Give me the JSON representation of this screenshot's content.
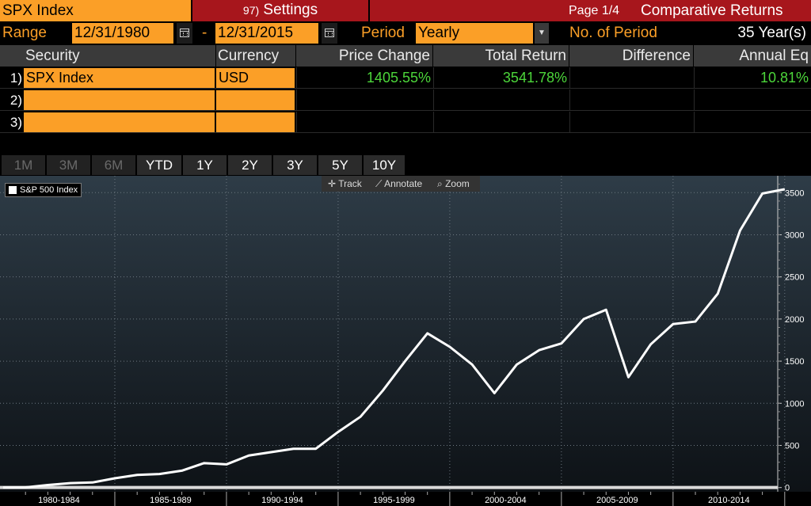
{
  "header": {
    "security": "SPX Index",
    "settings_num": "97)",
    "settings_label": "Settings",
    "page": "Page 1/4",
    "title": "Comparative Returns"
  },
  "range": {
    "label": "Range",
    "start": "12/31/1980",
    "dash": "-",
    "end": "12/31/2015",
    "period_label": "Period",
    "period_value": "Yearly",
    "num_period_label": "No. of Period",
    "num_period_value": "35 Year(s)"
  },
  "table": {
    "columns": [
      "Security",
      "Currency",
      "Price Change",
      "Total Return",
      "Difference",
      "Annual Eq"
    ],
    "rows": [
      {
        "num": "1)",
        "security": "SPX Index",
        "currency": "USD",
        "price_change": "1405.55%",
        "total_return": "3541.78%",
        "difference": "",
        "annual_eq": "10.81%"
      },
      {
        "num": "2)",
        "security": "",
        "currency": "",
        "price_change": "",
        "total_return": "",
        "difference": "",
        "annual_eq": ""
      },
      {
        "num": "3)",
        "security": "",
        "currency": "",
        "price_change": "",
        "total_return": "",
        "difference": "",
        "annual_eq": ""
      }
    ]
  },
  "tabs": [
    "1M",
    "3M",
    "6M",
    "YTD",
    "1Y",
    "2Y",
    "3Y",
    "5Y",
    "10Y"
  ],
  "tabs_disabled": [
    "1M",
    "3M",
    "6M"
  ],
  "toolbar": {
    "track": "Track",
    "annotate": "Annotate",
    "zoom": "Zoom"
  },
  "colors": {
    "orange": "#fb9f27",
    "red": "#a7161c",
    "green": "#4cd63a"
  },
  "chart_data": {
    "type": "line",
    "legend": [
      "S&P 500 Index"
    ],
    "xlabels": [
      "1980-1984",
      "1985-1989",
      "1990-1994",
      "1995-1999",
      "2000-2004",
      "2005-2009",
      "2010-2014"
    ],
    "ylim": [
      -50,
      3700
    ],
    "yticks": [
      0,
      500,
      1000,
      1500,
      2000,
      2500,
      3000,
      3500
    ],
    "grid": true,
    "series": [
      {
        "name": "S&P 500 Index",
        "x": [
          1980,
          1981,
          1982,
          1983,
          1984,
          1985,
          1986,
          1987,
          1988,
          1989,
          1990,
          1991,
          1992,
          1993,
          1994,
          1995,
          1996,
          1997,
          1998,
          1999,
          2000,
          2001,
          2002,
          2003,
          2004,
          2005,
          2006,
          2007,
          2008,
          2009,
          2010,
          2011,
          2012,
          2013,
          2014,
          2015
        ],
        "values": [
          0,
          2,
          30,
          52,
          60,
          110,
          150,
          160,
          200,
          290,
          275,
          380,
          420,
          460,
          460,
          660,
          840,
          1150,
          1500,
          1830,
          1670,
          1460,
          1120,
          1460,
          1630,
          1710,
          2000,
          2110,
          1310,
          1700,
          1940,
          1970,
          2300,
          3050,
          3490,
          3540
        ]
      }
    ]
  }
}
